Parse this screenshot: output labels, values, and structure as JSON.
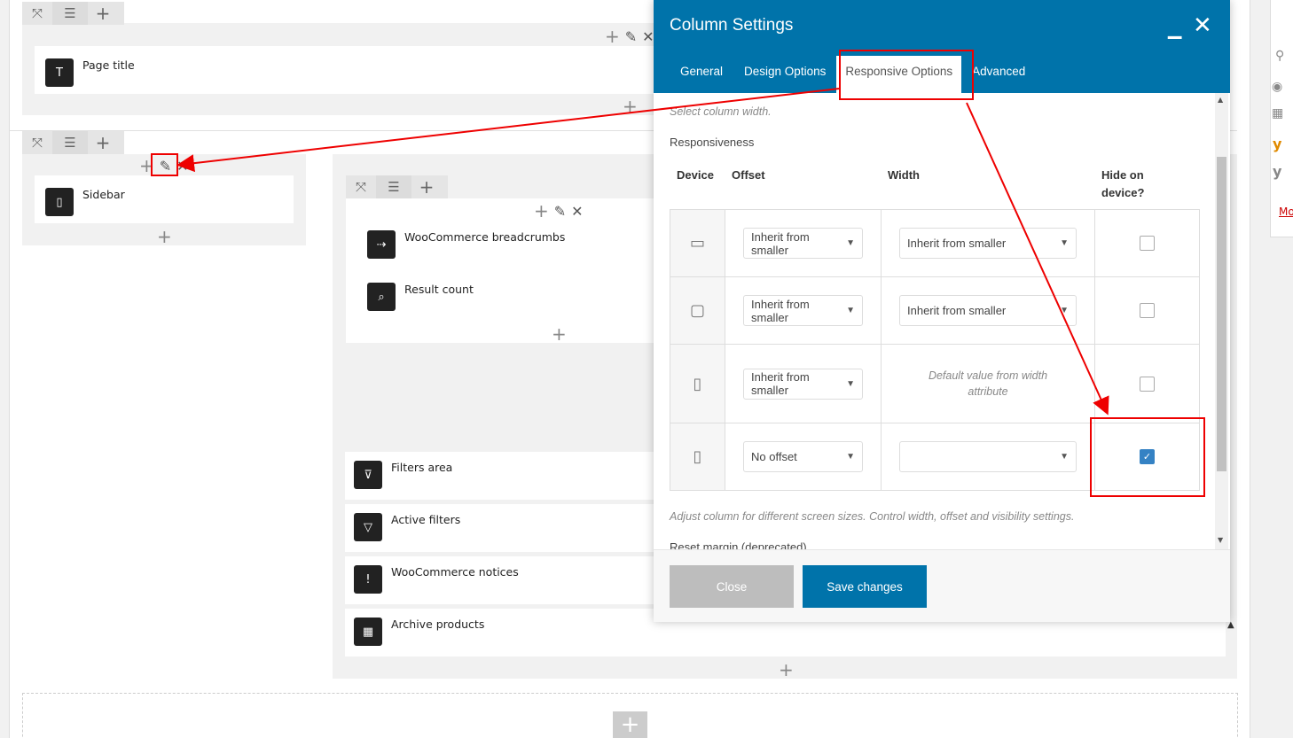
{
  "builder": {
    "row1_element": "Page title",
    "sidebar_element": "Sidebar",
    "main_elements": [
      "WooCommerce breadcrumbs",
      "Result count"
    ],
    "lower_elements": [
      "Filters area",
      "Active filters",
      "WooCommerce notices",
      "Archive products"
    ]
  },
  "modal": {
    "title": "Column Settings",
    "tabs": [
      "General",
      "Design Options",
      "Responsive Options",
      "Advanced"
    ],
    "active_tab": "Responsive Options",
    "select_width_hint": "Select column width.",
    "responsiveness_label": "Responsiveness",
    "headers": {
      "device": "Device",
      "offset": "Offset",
      "width": "Width",
      "hide_line1": "Hide on",
      "hide_line2": "device?"
    },
    "rows": [
      {
        "device_icon": "desktop-icon",
        "offset": "Inherit from smaller",
        "width": "Inherit from smaller",
        "hide": false
      },
      {
        "device_icon": "tablet-landscape-icon",
        "offset": "Inherit from smaller",
        "width": "Inherit from smaller",
        "hide": false
      },
      {
        "device_icon": "tablet-portrait-icon",
        "offset": "Inherit from smaller",
        "width_default_line1": "Default value from width",
        "width_default_line2": "attribute",
        "hide": false
      },
      {
        "device_icon": "mobile-icon",
        "offset": "No offset",
        "width": "",
        "hide": true
      }
    ],
    "adjust_hint": "Adjust column for different screen sizes. Control width, offset and visibility settings.",
    "reset_label": "Reset margin (deprecated)",
    "close_button": "Close",
    "save_button": "Save changes"
  },
  "sidebar_link": "Mo",
  "colors": {
    "header": "#0073aa",
    "highlight": "#e00000",
    "checkbox_on": "#3582c4",
    "close_btn": "#bdbdbd",
    "save_btn": "#0073aa"
  }
}
